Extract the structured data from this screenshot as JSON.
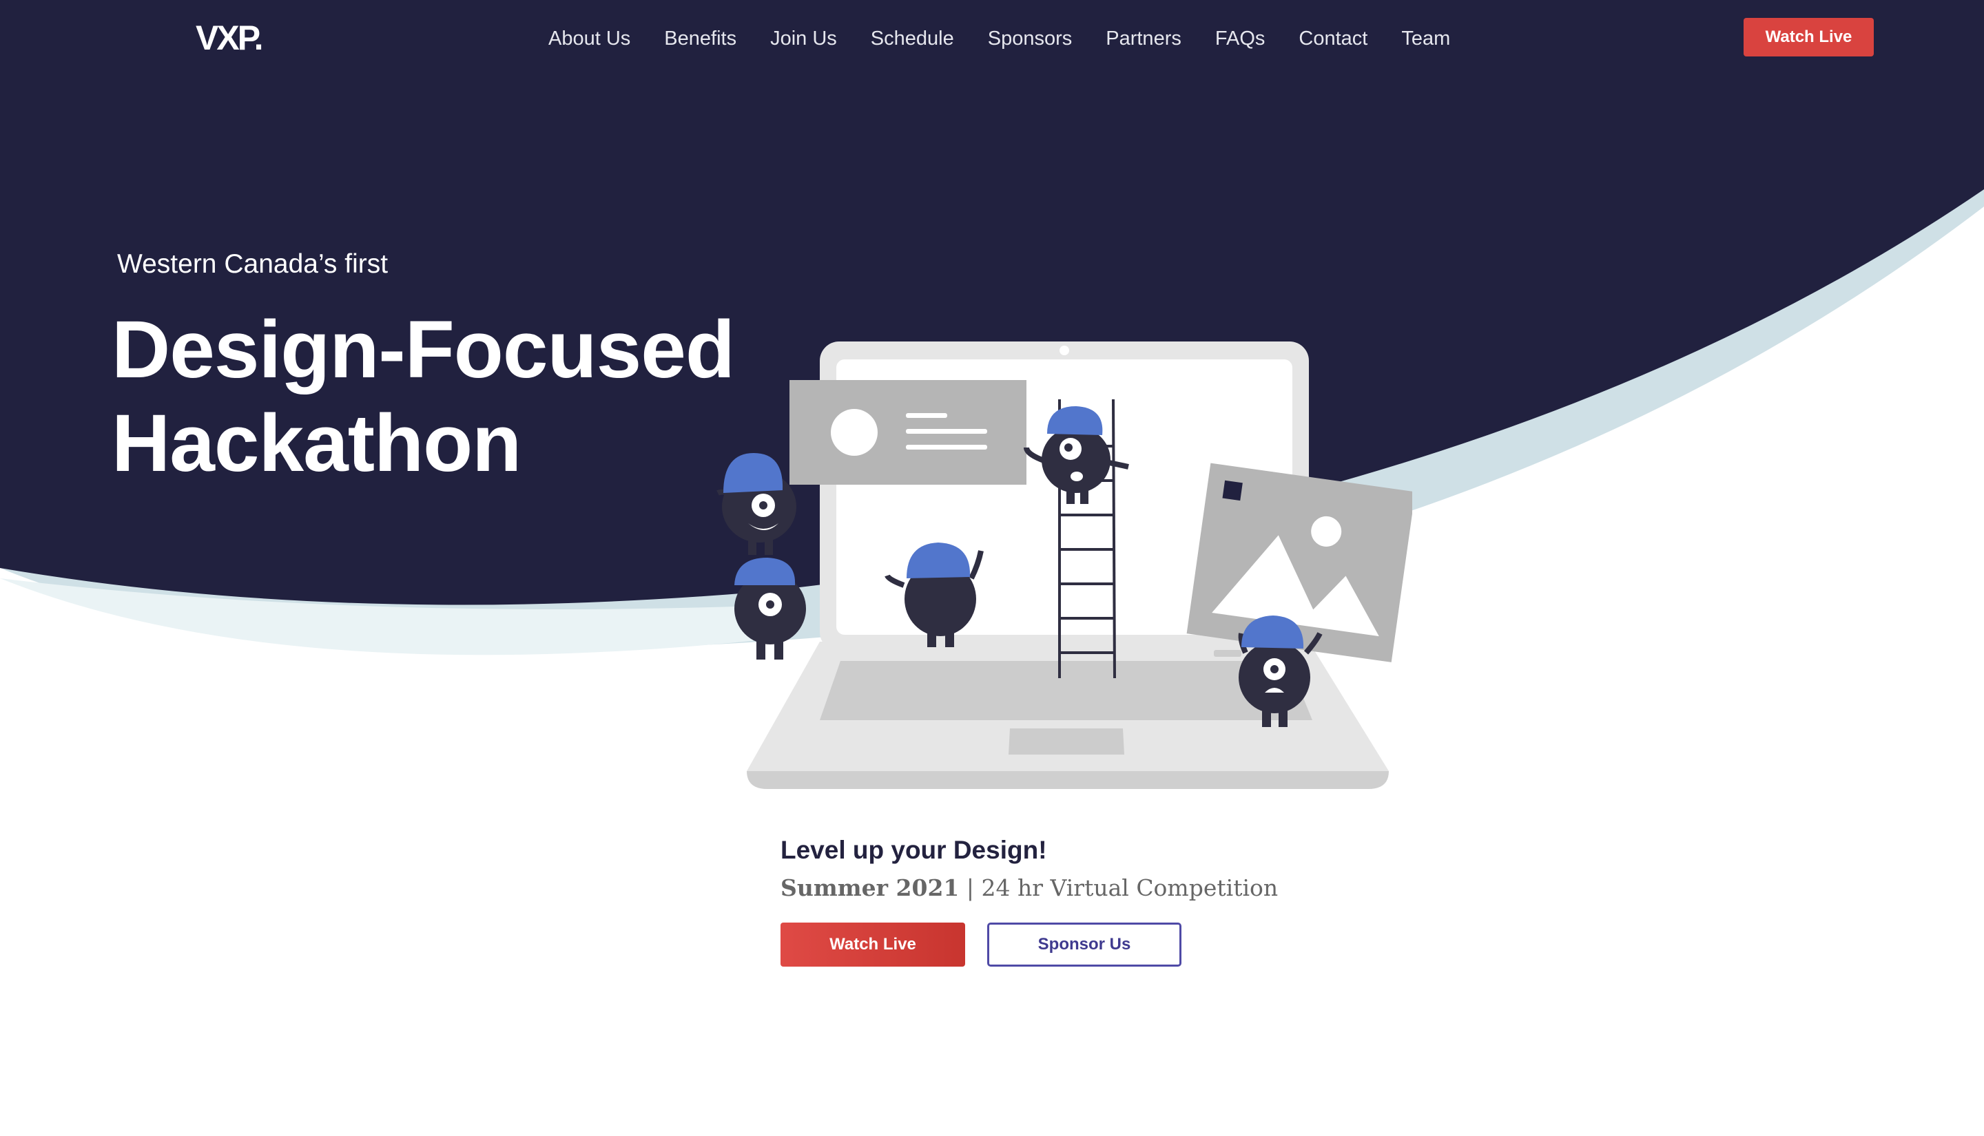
{
  "brand": {
    "logo_text": "VXP."
  },
  "nav": {
    "items": [
      {
        "label": "About Us"
      },
      {
        "label": "Benefits"
      },
      {
        "label": "Join Us"
      },
      {
        "label": "Schedule"
      },
      {
        "label": "Sponsors"
      },
      {
        "label": "Partners"
      },
      {
        "label": "FAQs"
      },
      {
        "label": "Contact"
      },
      {
        "label": "Team"
      }
    ],
    "cta_label": "Watch Live"
  },
  "hero": {
    "subtitle": "Western Canada’s first",
    "title_line1": "Design-Focused",
    "title_line2": "Hackathon",
    "illustration": "laptop-team-collaboration"
  },
  "details": {
    "tagline": "Level up your Design!",
    "season": "Summer 2021",
    "separator": " | ",
    "format": "24 hr Virtual Competition",
    "watch_label": "Watch Live",
    "sponsor_label": "Sponsor Us"
  },
  "colors": {
    "navy": "#21213f",
    "accent_red": "#d9433f",
    "secondary_purple": "#4f4aa6",
    "wave_light_blue": "#d2e4ea",
    "character_cap_blue": "#5276cc"
  }
}
